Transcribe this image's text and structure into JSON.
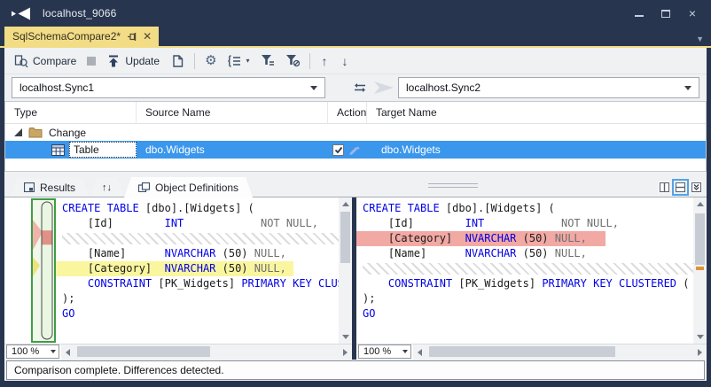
{
  "window": {
    "title": "localhost_9066"
  },
  "doc_tab": {
    "label": "SqlSchemaCompare2*"
  },
  "icons": {
    "close_window": "×",
    "tab_close": "✕",
    "gear": "⚙",
    "caret_down": "▾",
    "prev_diff": "↑",
    "next_diff": "↓",
    "sort_tab": "↑↓",
    "tab_overflow": "▼"
  },
  "toolbar": {
    "compare_label": "Compare",
    "update_label": "Update"
  },
  "connections": {
    "source": "localhost.Sync1",
    "target": "localhost.Sync2"
  },
  "grid": {
    "columns": {
      "type": "Type",
      "source": "Source Name",
      "action": "Action",
      "target": "Target Name"
    },
    "group_label": "Change",
    "row": {
      "type": "Table",
      "source_name": "dbo.Widgets",
      "target_name": "dbo.Widgets",
      "checked": true
    }
  },
  "panel_tabs": {
    "results": "Results",
    "object_definitions": "Object Definitions"
  },
  "editors": {
    "zoom_left": "100 %",
    "zoom_right": "100 %",
    "left_lines": [
      {
        "hl": "",
        "segs": [
          [
            "k",
            "CREATE TABLE"
          ],
          [
            "p",
            " [dbo].[Widgets] ("
          ]
        ]
      },
      {
        "hl": "",
        "segs": [
          [
            "p",
            "    [Id]        "
          ],
          [
            "k",
            "INT"
          ],
          [
            "p",
            "            "
          ],
          [
            "g",
            "NOT NULL,"
          ]
        ]
      },
      {
        "hl": "hatch",
        "segs": []
      },
      {
        "hl": "",
        "segs": [
          [
            "p",
            "    [Name]      "
          ],
          [
            "k",
            "NVARCHAR"
          ],
          [
            "p",
            " (50) "
          ],
          [
            "g",
            "NULL,"
          ]
        ]
      },
      {
        "hl": "yellow",
        "segs": [
          [
            "p",
            "    [Category]  "
          ],
          [
            "k",
            "NVARCHAR"
          ],
          [
            "p",
            " (50) "
          ],
          [
            "g",
            "NULL,"
          ]
        ]
      },
      {
        "hl": "",
        "segs": [
          [
            "p",
            "    "
          ],
          [
            "k",
            "CONSTRAINT"
          ],
          [
            "p",
            " [PK_Widgets] "
          ],
          [
            "k",
            "PRIMARY KEY CLUSTERED"
          ],
          [
            "p",
            " ("
          ]
        ]
      },
      {
        "hl": "",
        "segs": [
          [
            "p",
            ");"
          ]
        ]
      },
      {
        "hl": "",
        "segs": [
          [
            "k",
            "GO"
          ]
        ]
      }
    ],
    "right_lines": [
      {
        "hl": "",
        "segs": [
          [
            "k",
            "CREATE TABLE"
          ],
          [
            "p",
            " [dbo].[Widgets] ("
          ]
        ]
      },
      {
        "hl": "",
        "segs": [
          [
            "p",
            "    [Id]        "
          ],
          [
            "k",
            "INT"
          ],
          [
            "p",
            "            "
          ],
          [
            "g",
            "NOT NULL,"
          ]
        ]
      },
      {
        "hl": "pink",
        "segs": [
          [
            "p",
            "    [Category]  "
          ],
          [
            "k",
            "NVARCHAR"
          ],
          [
            "p",
            " (50) "
          ],
          [
            "g",
            "NULL,"
          ]
        ]
      },
      {
        "hl": "",
        "segs": [
          [
            "p",
            "    [Name]      "
          ],
          [
            "k",
            "NVARCHAR"
          ],
          [
            "p",
            " (50) "
          ],
          [
            "g",
            "NULL,"
          ]
        ]
      },
      {
        "hl": "hatch",
        "segs": []
      },
      {
        "hl": "",
        "segs": [
          [
            "p",
            "    "
          ],
          [
            "k",
            "CONSTRAINT"
          ],
          [
            "p",
            " [PK_Widgets] "
          ],
          [
            "k",
            "PRIMARY KEY CLUSTERED"
          ],
          [
            "p",
            " ("
          ]
        ]
      },
      {
        "hl": "",
        "segs": [
          [
            "p",
            ");"
          ]
        ]
      },
      {
        "hl": "",
        "segs": [
          [
            "k",
            "GO"
          ]
        ]
      }
    ]
  },
  "status_bar": {
    "message": "Comparison complete.  Differences detected."
  },
  "colors": {
    "titlebar_navy": "#28354E",
    "tab_yellow": "#F2DC86",
    "selection_blue": "#3B97EC",
    "diff_changed_yellow": "#FAF6A0",
    "diff_changed_pink": "#F2A9A4",
    "keyword_blue": "#0000E6",
    "nullable_gray": "#6F6F6F",
    "diffmap_green_border": "#3F9E46",
    "scroll_diff_tick_orange": "#E2913B"
  }
}
